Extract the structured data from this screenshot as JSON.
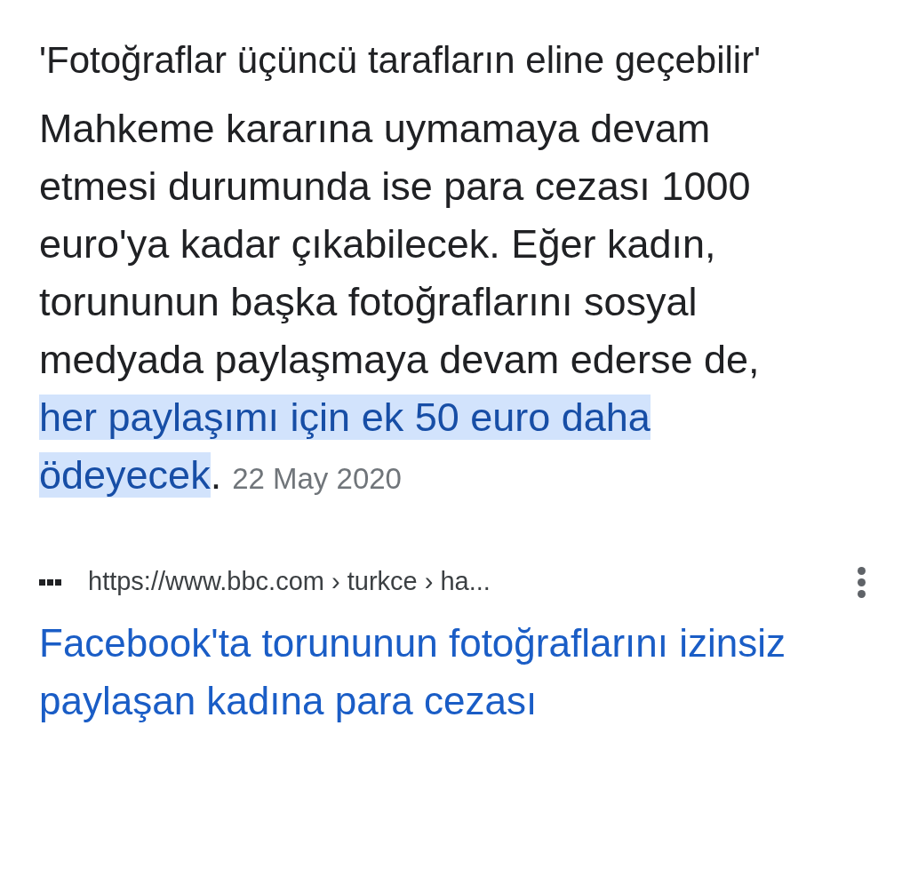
{
  "snippet": {
    "heading": "'Fotoğraflar üçüncü tarafların eline geçebilir'",
    "text_before": "Mahkeme kararına uymamaya devam etmesi durumunda ise para cezası 1000 euro'ya kadar çıkabilecek. Eğer kadın, torununun başka fotoğraflarını sosyal medyada paylaşmaya devam ederse de, ",
    "highlight": "her paylaşımı için ek 50 euro daha ödeyecek",
    "text_after": ".",
    "date": "22 May 2020"
  },
  "result": {
    "url": "https://www.bbc.com › turkce › ha...",
    "title": "Facebook'ta torununun fotoğraflarını izinsiz paylaşan kadına para cezası"
  }
}
